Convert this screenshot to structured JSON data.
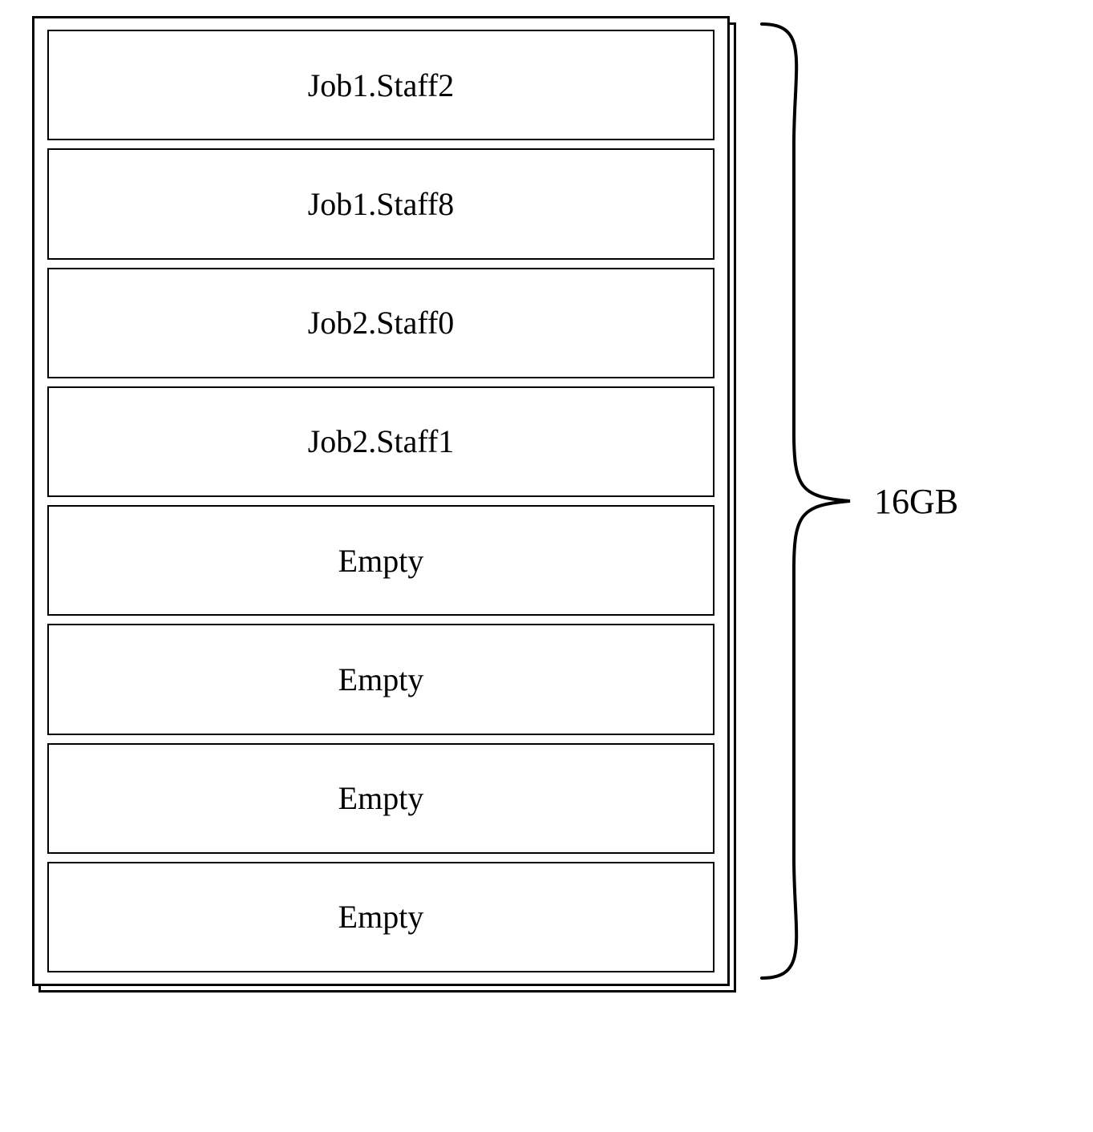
{
  "chart_data": {
    "type": "table",
    "title": "",
    "total_size_label": "16GB",
    "slot_count": 8,
    "slots": [
      {
        "label": "Job1.Staff2",
        "state": "occupied"
      },
      {
        "label": "Job1.Staff8",
        "state": "occupied"
      },
      {
        "label": "Job2.Staff0",
        "state": "occupied"
      },
      {
        "label": "Job2.Staff1",
        "state": "occupied"
      },
      {
        "label": "Empty",
        "state": "empty"
      },
      {
        "label": "Empty",
        "state": "empty"
      },
      {
        "label": "Empty",
        "state": "empty"
      },
      {
        "label": "Empty",
        "state": "empty"
      }
    ]
  }
}
